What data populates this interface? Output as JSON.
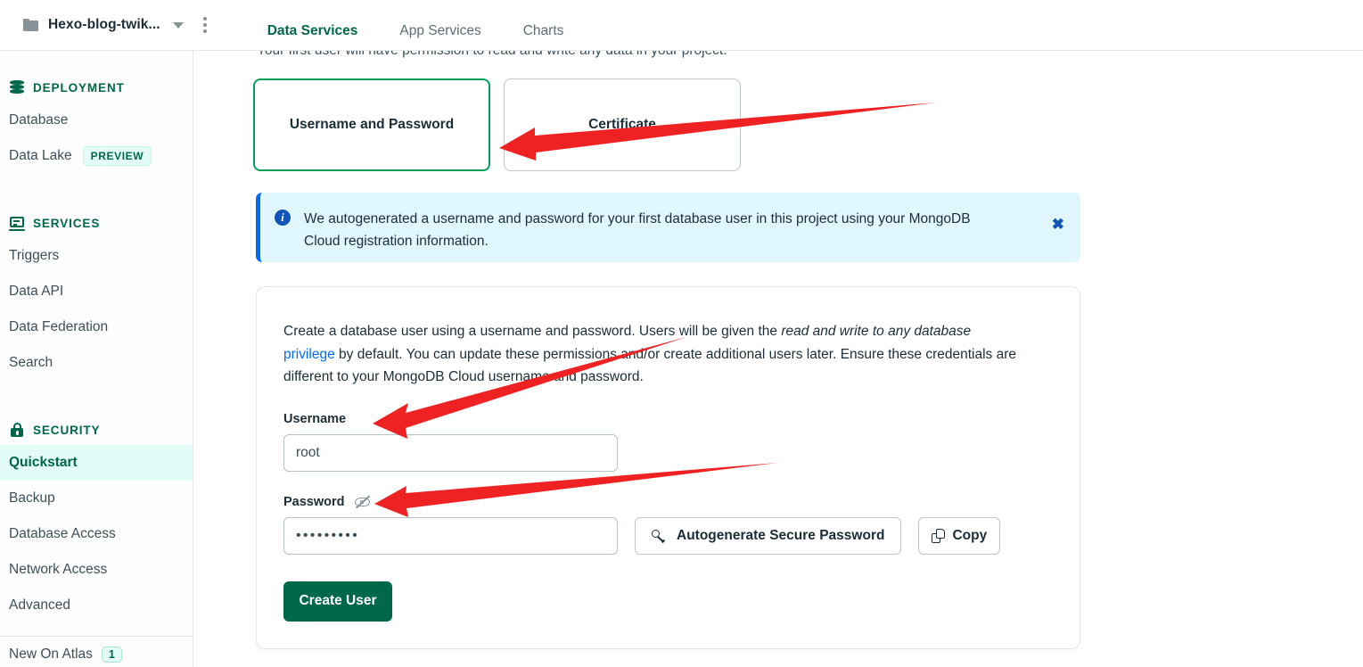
{
  "topbar": {
    "project_name": "Hexo-blog-twik...",
    "folder_icon": "folder-icon",
    "caret_icon": "chevron-down-icon",
    "menu_icon": "kebab-menu-icon",
    "tabs": [
      {
        "label": "Data Services",
        "active": true
      },
      {
        "label": "App Services",
        "active": false
      },
      {
        "label": "Charts",
        "active": false
      }
    ]
  },
  "sidebar": {
    "sections": [
      {
        "title": "DEPLOYMENT",
        "icon": "database-stack-icon",
        "items": [
          {
            "label": "Database",
            "badge": null,
            "active": false
          },
          {
            "label": "Data Lake",
            "badge": "PREVIEW",
            "active": false
          }
        ]
      },
      {
        "title": "SERVICES",
        "icon": "laptop-icon",
        "items": [
          {
            "label": "Triggers",
            "badge": null,
            "active": false
          },
          {
            "label": "Data API",
            "badge": null,
            "active": false
          },
          {
            "label": "Data Federation",
            "badge": null,
            "active": false
          },
          {
            "label": "Search",
            "badge": null,
            "active": false
          }
        ]
      },
      {
        "title": "SECURITY",
        "icon": "lock-icon",
        "items": [
          {
            "label": "Quickstart",
            "badge": null,
            "active": true
          },
          {
            "label": "Backup",
            "badge": null,
            "active": false
          },
          {
            "label": "Database Access",
            "badge": null,
            "active": false
          },
          {
            "label": "Network Access",
            "badge": null,
            "active": false
          },
          {
            "label": "Advanced",
            "badge": null,
            "active": false
          }
        ]
      }
    ],
    "footer": {
      "label": "New On Atlas",
      "count": "1"
    }
  },
  "main": {
    "scrolled_text": "Your first user will have permission to read and write any data in your project.",
    "auth_methods": [
      {
        "label": "Username and Password",
        "selected": true
      },
      {
        "label": "Certificate",
        "selected": false
      }
    ],
    "banner": {
      "icon": "info-circle-icon",
      "text": "We autogenerated a username and password for your first database user in this project using your MongoDB Cloud registration information.",
      "close_icon": "close-icon"
    },
    "form": {
      "description_part1": "Create a database user using a username and password. Users will be given the ",
      "description_em": "read and write to any database",
      "description_link": "privilege",
      "description_part2": " by default. You can update these permissions and/or create additional users later. Ensure these credentials are different to your MongoDB Cloud username and password.",
      "username_label": "Username",
      "username_value": "root",
      "password_label": "Password",
      "password_toggle_icon": "eye-slash-icon",
      "password_value": "•••••••••",
      "autogenerate_label": "Autogenerate Secure Password",
      "autogenerate_icon": "key-icon",
      "copy_label": "Copy",
      "copy_icon": "copy-icon",
      "submit_label": "Create User"
    }
  },
  "annotations": {
    "color": "#ee2222",
    "arrows": [
      {
        "name": "arrow-to-username-password-card"
      },
      {
        "name": "arrow-to-username-label"
      },
      {
        "name": "arrow-to-password-toggle"
      }
    ]
  },
  "colors": {
    "brand_green": "#00684a",
    "accent_green": "#00a35c",
    "active_bg": "#e3fcf7",
    "info_blue": "#016bf8",
    "info_bg": "#e1f7ff",
    "annotation_red": "#ee2222"
  }
}
